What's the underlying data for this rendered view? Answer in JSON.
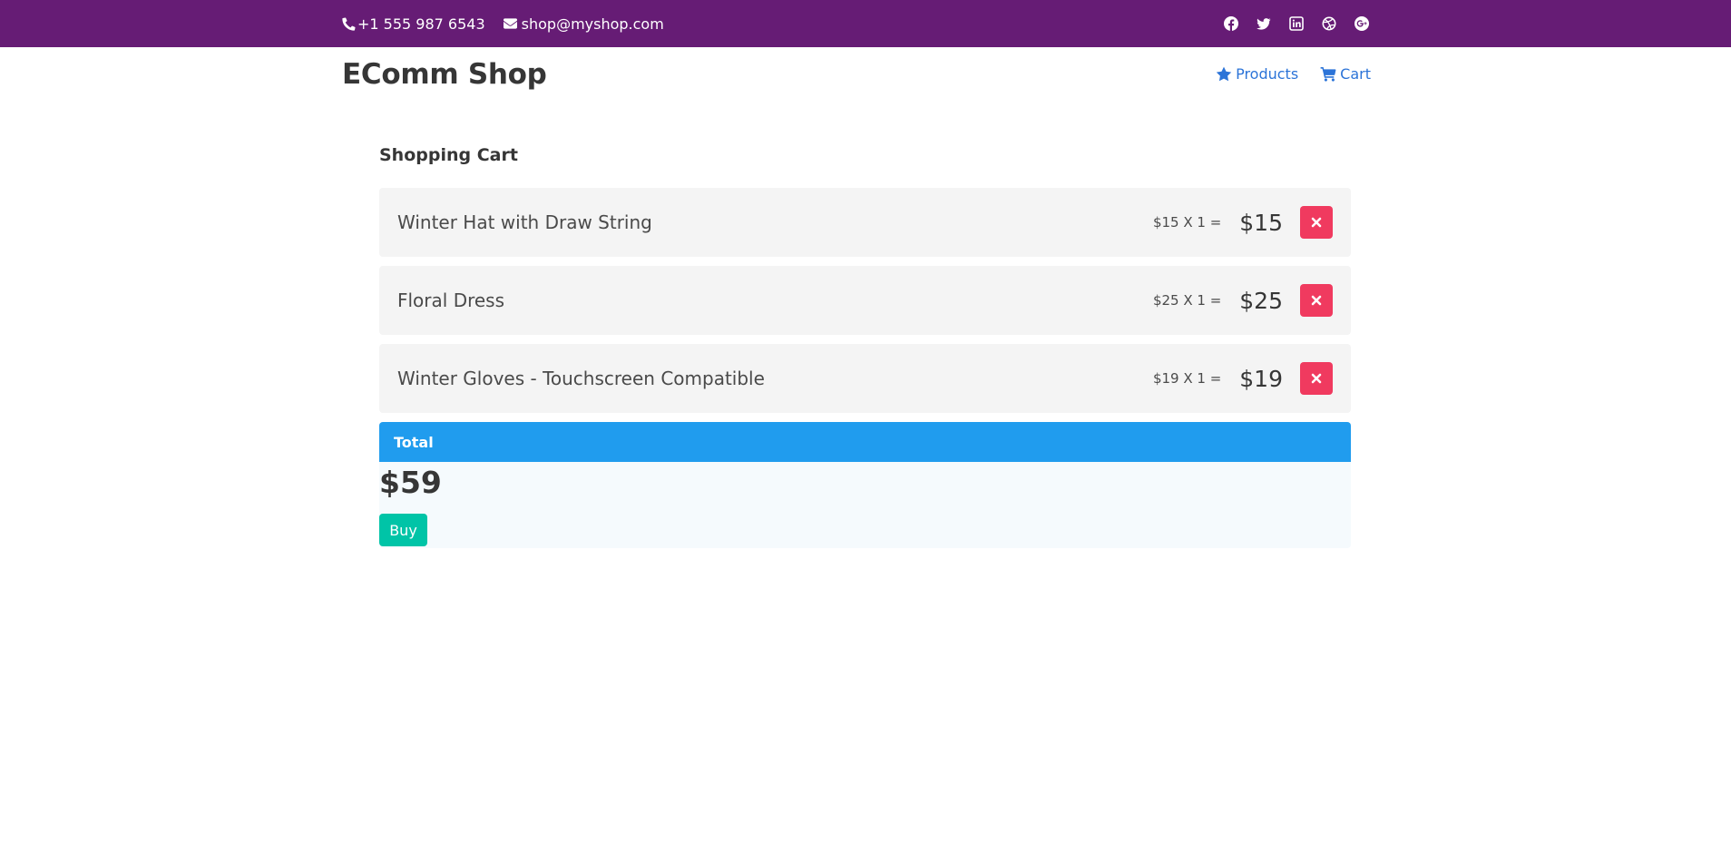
{
  "topbar": {
    "phone": "+1 555 987 6543",
    "email": "shop@myshop.com",
    "phone_icon": "phone-icon",
    "email_icon": "envelope-icon",
    "socials": [
      "facebook-icon",
      "twitter-icon",
      "linkedin-icon",
      "dribbble-icon",
      "google-plus-icon"
    ],
    "background": "#661c75"
  },
  "header": {
    "brand": "EComm Shop",
    "nav": [
      {
        "label": "Products",
        "icon": "star-icon"
      },
      {
        "label": "Cart",
        "icon": "cart-icon"
      }
    ],
    "link_color": "#2c74d8"
  },
  "cart": {
    "title": "Shopping Cart",
    "items": [
      {
        "name": "Winter Hat with Draw String",
        "calc": "$15 X 1 =",
        "price": "$15"
      },
      {
        "name": "Floral Dress",
        "calc": "$25 X 1 =",
        "price": "$25"
      },
      {
        "name": "Winter Gloves - Touchscreen Compatible",
        "calc": "$19 X 1 =",
        "price": "$19"
      }
    ],
    "remove_icon": "close-icon",
    "remove_color": "#f03a5f",
    "total_label": "Total",
    "total_color": "#209cee",
    "total_amount": "$59",
    "buy_label": "Buy",
    "buy_color": "#00c4a7"
  }
}
